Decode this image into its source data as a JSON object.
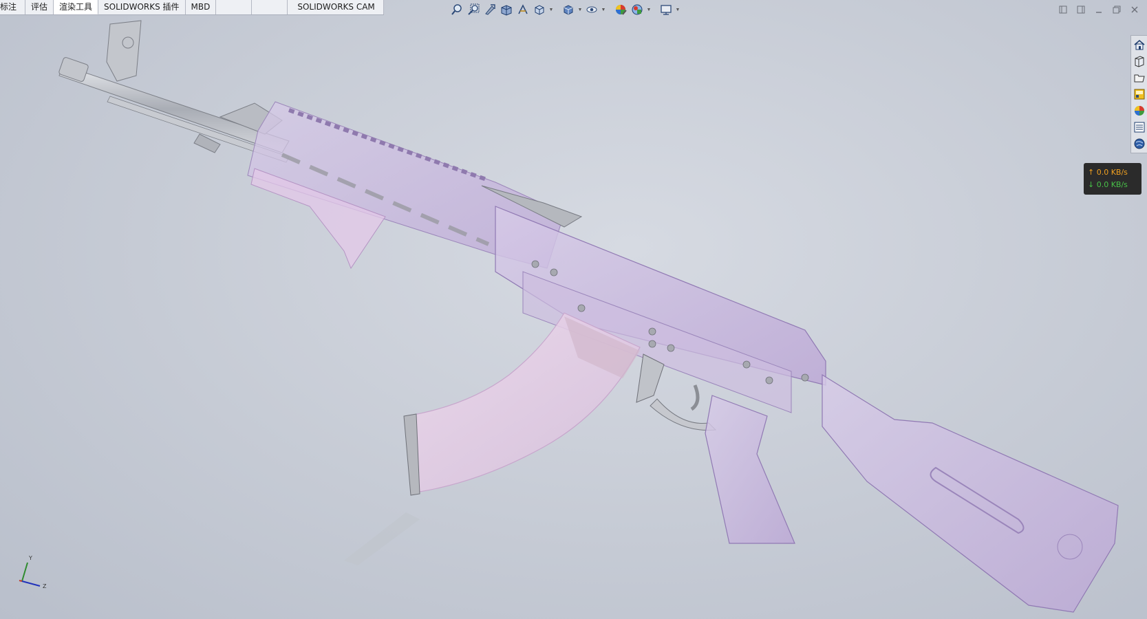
{
  "tabs": [
    {
      "label": "标注",
      "active": false
    },
    {
      "label": "评估",
      "active": false
    },
    {
      "label": "渲染工具",
      "active": true
    },
    {
      "label": "SOLIDWORKS 插件",
      "active": false
    },
    {
      "label": "MBD",
      "active": false
    },
    {
      "label": "",
      "active": false
    },
    {
      "label": "",
      "active": false
    },
    {
      "label": "SOLIDWORKS CAM",
      "active": false
    }
  ],
  "view_toolbar": {
    "icons": [
      "zoom-to-fit-icon",
      "zoom-to-area-icon",
      "previous-view-icon",
      "section-view-icon",
      "dynamic-annotation-icon",
      "view-orientation-icon",
      "display-style-icon",
      "hide-show-items-icon",
      "edit-appearance-icon",
      "apply-scene-icon",
      "view-settings-icon"
    ]
  },
  "window_controls": [
    "restore-left-icon",
    "restore-right-icon",
    "minimize-icon",
    "maximize-icon",
    "close-icon"
  ],
  "task_pane": [
    "home-icon",
    "design-library-icon",
    "file-explorer-icon",
    "view-palette-icon",
    "appearances-icon",
    "custom-properties-icon",
    "forum-icon"
  ],
  "net_speed": {
    "upload": "↑ 0.0 KB/s",
    "download": "↓ 0.0 KB/s"
  },
  "triad": {
    "y": "Y",
    "z": "Z"
  },
  "colors": {
    "background": "#c9ced8",
    "model_purple": "#c7b6dc",
    "metal": "#b8bcc2",
    "upload": "#f0a020",
    "download": "#48c048"
  }
}
